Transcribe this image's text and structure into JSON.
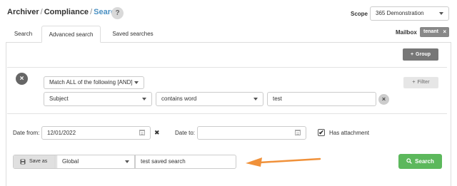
{
  "breadcrumb": {
    "root": "Archiver",
    "middle": "Compliance",
    "current": "Search",
    "separator": "/"
  },
  "help": {
    "label": "?"
  },
  "scope": {
    "label": "Scope",
    "value": "365 Demonstration"
  },
  "tabs": [
    {
      "label": "Search"
    },
    {
      "label": "Advanced search"
    },
    {
      "label": "Saved searches"
    }
  ],
  "mailbox": {
    "label": "Mailbox",
    "tag": "tenant",
    "tag_remove": "×"
  },
  "group_button": {
    "label": "Group",
    "icon": "+"
  },
  "filter_button": {
    "label": "Filter",
    "icon": "+"
  },
  "rule_group": {
    "remove_icon": "×",
    "match": "Match ALL of the following [AND]",
    "rule": {
      "field": "Subject",
      "operator": "contains word",
      "value": "test",
      "remove_icon": "×"
    }
  },
  "dates": {
    "from_label": "Date from:",
    "from_value": "12/01/2022",
    "clear_icon": "✖",
    "to_label": "Date to:",
    "to_value": "",
    "has_attachment_label": "Has attachment",
    "has_attachment_checked": "✔"
  },
  "save": {
    "button_label": "Save as",
    "scope_value": "Global",
    "name_value": "test saved search"
  },
  "search_button": {
    "label": "Search"
  },
  "colors": {
    "accent": "#4a90c2",
    "success": "#5cb85c",
    "annotation_arrow": "#f0913a"
  }
}
